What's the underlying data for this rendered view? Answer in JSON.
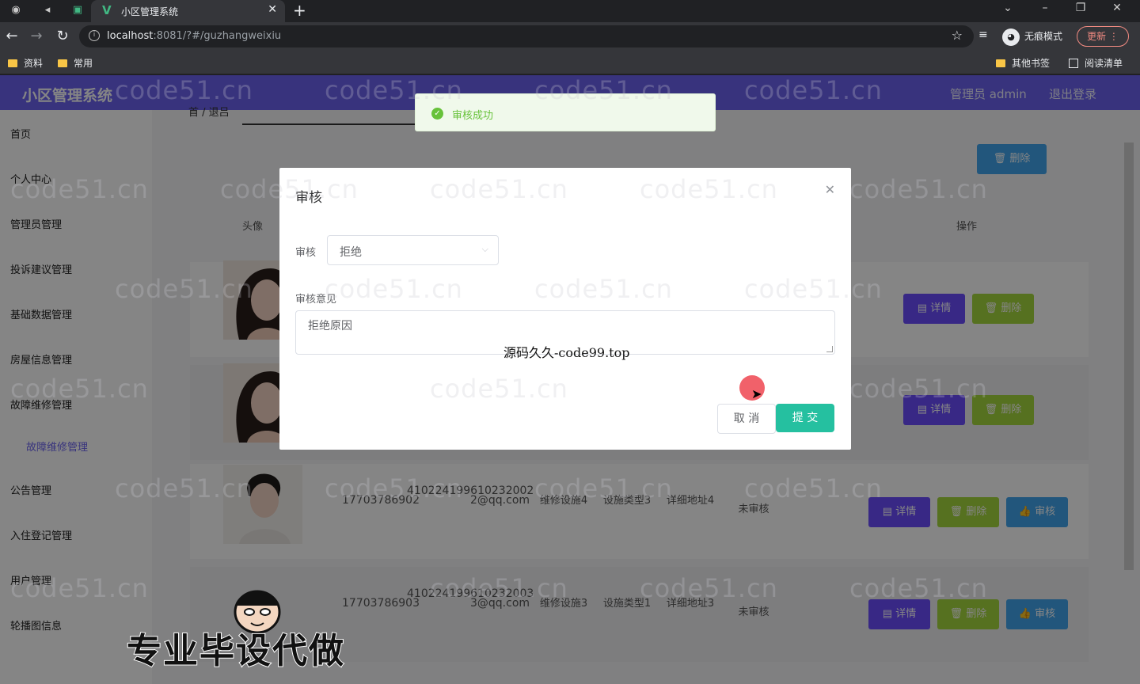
{
  "browser": {
    "tab_title": "小区管理系统",
    "url_host": "localhost",
    "url_path": ":8081/?#/guzhangweixiu",
    "incognito_label": "无痕模式",
    "update_label": "更新",
    "bookmarks": [
      "资料",
      "常用"
    ],
    "other_bookmarks": "其他书签",
    "reading_list": "阅读清单"
  },
  "app": {
    "brand": "小区管理系统",
    "admin_label": "管理员 admin",
    "logout_label": "退出登录"
  },
  "sidebar": {
    "items": [
      "首页",
      "个人中心",
      "管理员管理",
      "投诉建议管理",
      "基础数据管理",
      "房屋信息管理",
      "故障维修管理",
      "公告管理",
      "入住登记管理",
      "用户管理",
      "轮播图信息"
    ],
    "active_sub": "故障维修管理"
  },
  "content": {
    "breadcrumb": "首 / 退吕",
    "top_delete": "删除",
    "head_avatar": "头像",
    "head_ops": "操作",
    "rows": [
      {
        "phone": "",
        "id": "",
        "email": "",
        "fac": "",
        "type": "",
        "addr": "",
        "status": "",
        "btns": [
          "详情",
          "删除"
        ]
      },
      {
        "phone": "",
        "id": "",
        "email": "",
        "fac": "",
        "type": "",
        "addr": "",
        "status": "",
        "btns": [
          "详情",
          "删除"
        ]
      },
      {
        "phone": "17703786902",
        "id": "410224199610232002",
        "email": "2@qq.com",
        "fac": "维修设施4",
        "type": "设施类型3",
        "addr": "详细地址4",
        "status": "未审核",
        "btns": [
          "详情",
          "删除",
          "审核"
        ]
      },
      {
        "phone": "17703786903",
        "id": "410224199610232003",
        "email": "3@qq.com",
        "fac": "维修设施3",
        "type": "设施类型1",
        "addr": "详细地址3",
        "status": "未审核",
        "btns": [
          "详情",
          "删除",
          "审核"
        ]
      }
    ]
  },
  "toast": {
    "text": "审核成功",
    "color": "#67c23a"
  },
  "dialog": {
    "title": "审核",
    "field_label": "审核",
    "field_value": "拒绝",
    "opinion_label": "审核意见",
    "opinion_value": "拒绝原因",
    "cancel": "取 消",
    "submit": "提 交"
  },
  "watermark": {
    "text": "code51.cn",
    "center": "源码久久-code99.top",
    "banner": "专业毕设代做"
  },
  "colors": {
    "accent": "#6b63f0",
    "submit": "#25c0a0"
  }
}
